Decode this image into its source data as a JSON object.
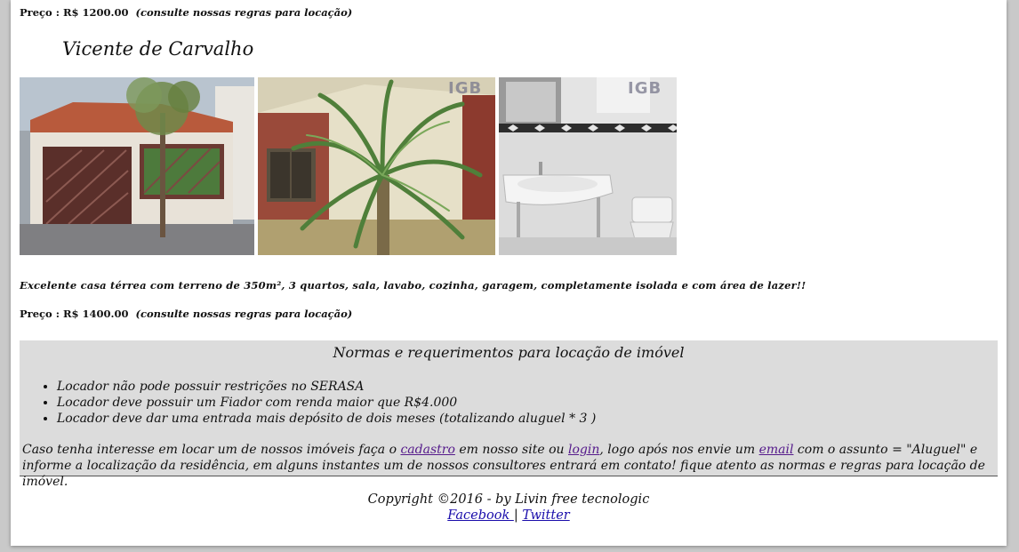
{
  "listing1": {
    "price_label": "Preço : R$ 1200.00",
    "price_note": "(consulte nossas regras para locação)"
  },
  "listing2": {
    "title": "Vicente de Carvalho",
    "photos": [
      {
        "name": "house-front-photo",
        "watermark": ""
      },
      {
        "name": "palm-tree-photo",
        "watermark": "IGB"
      },
      {
        "name": "bathroom-photo",
        "watermark": "IGB"
      }
    ],
    "description": "Excelente casa térrea com terreno de 350m², 3 quartos, sala, lavabo, cozinha, garagem, completamente isolada e com área de lazer!!",
    "price_label": "Preço : R$ 1400.00",
    "price_note": "(consulte nossas regras para locação)"
  },
  "rules": {
    "title": "Normas e requerimentos para locação de imóvel",
    "items": [
      "Locador não pode possuir restrições no SERASA",
      "Locador deve possuir um Fiador com renda maior que R$4.000",
      "Locador deve dar uma entrada mais depósito de dois meses (totalizando aluguel * 3 )"
    ],
    "text_part1": "Caso tenha interesse em locar um de nossos imóveis faça o ",
    "link_cadastro": "cadastro",
    "text_part2": " em nosso site ou ",
    "link_login": "login",
    "text_part3": ", logo após nos envie um ",
    "link_email": "email",
    "text_part4": " com o assunto = \"Aluguel\" e informe a localização da residência, em alguns instantes um de nossos consultores entrará em contato! fique atento as normas e regras para locação de imóvel."
  },
  "footer": {
    "copyright": "Copyright ©2016 - by Livin free tecnologic",
    "facebook": "Facebook ",
    "separator": "|",
    "twitter": "Twitter"
  },
  "colors": {
    "rules_background": "#dcdcdc",
    "visited_link": "#551a8b",
    "link": "#1a0dab"
  }
}
